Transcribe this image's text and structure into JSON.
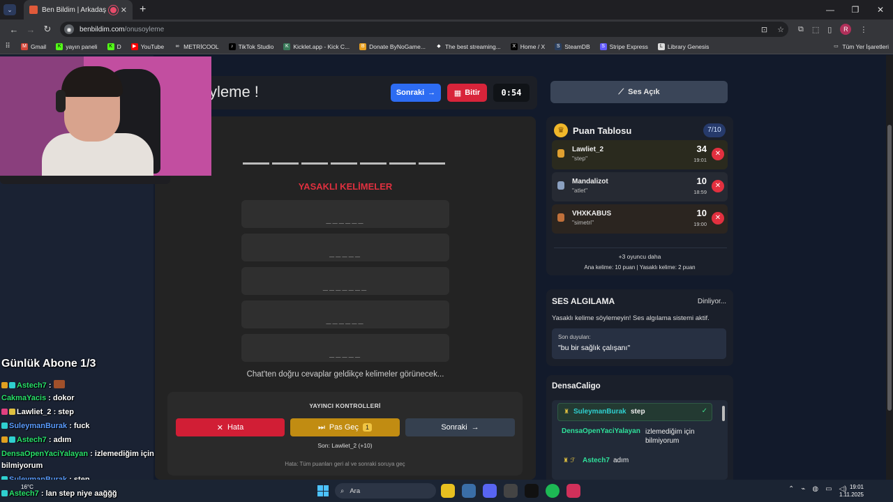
{
  "browser": {
    "tab_title": "Ben Bildim | Arkadaşlarınla",
    "url_host": "benbildim.com",
    "url_path": "/onusoyleme",
    "bookmarks": [
      "Gmail",
      "yayın paneli",
      "D",
      "YouTube",
      "METRİCOOL",
      "TikTok Studio",
      "Kicklet.app - Kick C...",
      "Donate ByNoGame...",
      "The best streaming...",
      "Home / X",
      "SteamDB",
      "Stripe Express",
      "Library Genesis"
    ],
    "bookmarks_folder": "Tüm Yer İşaretleri",
    "profile_initial": "R"
  },
  "game": {
    "title_visible": "yleme !",
    "next_label": "Sonraki",
    "finish_label": "Bitir",
    "timer": "0:54",
    "forbidden_title": "YASAKLI KELİMELER",
    "forbidden": [
      "______",
      "_____",
      "_______",
      "______",
      "_____"
    ],
    "chat_hint": "Chat'ten doğru cevaplar geldikçe kelimeler görünecek..."
  },
  "controls": {
    "title": "YAYINCI KONTROLLERİ",
    "error_label": "Hata",
    "pass_label": "Pas Geç",
    "pass_count": "1",
    "next_label": "Sonraki",
    "last": "Son: Lawliet_2 (+10)",
    "note": "Hata: Tüm puanları geri al ve sonraki soruya geç"
  },
  "sound_button": "Ses Açık",
  "leaderboard": {
    "title": "Puan Tablosu",
    "count": "7/10",
    "rows": [
      {
        "name": "Lawliet_2",
        "answer": "\"step\"",
        "points": "34",
        "time": "19:01"
      },
      {
        "name": "Mandalizot",
        "answer": "\"atlet\"",
        "points": "10",
        "time": "18:59"
      },
      {
        "name": "VHXKABUS",
        "answer": "\"simetri\"",
        "points": "10",
        "time": "19:00"
      }
    ],
    "more": "+3 oyuncu daha",
    "scoring": "Ana kelime: 10 puan | Yasaklı kelime: 2 puan"
  },
  "voice": {
    "title": "SES ALGILAMA",
    "status": "Dinliyor...",
    "warning": "Yasaklı kelime söylemeyin! Ses algılama sistemi aktif.",
    "heard_label": "Son duyulan:",
    "heard_value": "\"bu bir sağlık çalışanı\""
  },
  "chat": {
    "title": "DensaCaligo",
    "messages": [
      {
        "user": "SuleymanBurak",
        "text": "step"
      },
      {
        "user": "DensaOpenYaciYalayan",
        "text": "izlemediğim için bilmiyorum"
      },
      {
        "user": "Astech7",
        "text": "adım"
      }
    ]
  },
  "overlay": {
    "sub_goal": "Günlük Abone 1/3",
    "lines": [
      {
        "user": "Astech7",
        "text": " : "
      },
      {
        "user": "CakmaYacis",
        "text": " : dokor"
      },
      {
        "user": "Lawliet_2",
        "text": " : step"
      },
      {
        "user": "SuleymanBurak",
        "text": " : fuck"
      },
      {
        "user": "Astech7",
        "text": " : adım"
      },
      {
        "user": "DensaOpenYaciYalayan",
        "text": " : izlemediğim için"
      },
      {
        "user": "",
        "text": "bilmiyorum"
      },
      {
        "user": "SuleymanBurak",
        "text": " : step"
      },
      {
        "user": "Astech7",
        "text": " : lan step niye aağğğ"
      }
    ]
  },
  "taskbar": {
    "search": "Ara",
    "temp": "16°C",
    "time": "19:01",
    "date": "1.11.2025"
  }
}
